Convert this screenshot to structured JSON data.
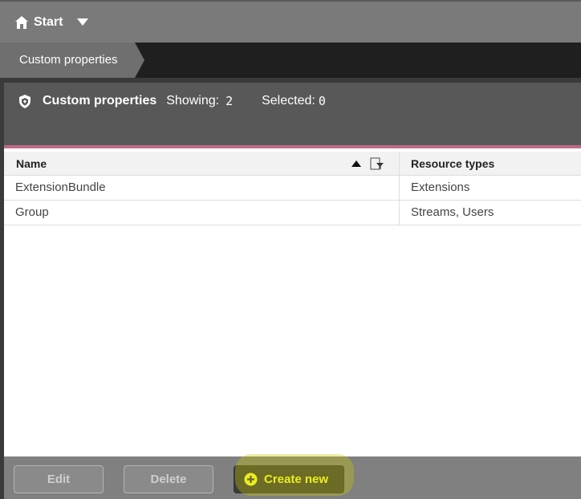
{
  "topbar": {
    "home_label": "Start"
  },
  "breadcrumb": {
    "current": "Custom properties"
  },
  "header": {
    "title": "Custom properties",
    "showing_label": "Showing:",
    "showing_count": "2",
    "selected_label": "Selected:",
    "selected_count": "0"
  },
  "table": {
    "columns": [
      "Name",
      "Resource types"
    ],
    "rows": [
      {
        "name": "ExtensionBundle",
        "resource_types": "Extensions"
      },
      {
        "name": "Group",
        "resource_types": "Streams, Users"
      }
    ]
  },
  "footer": {
    "edit_label": "Edit",
    "delete_label": "Delete",
    "create_label": "Create new"
  },
  "colors": {
    "accent_stripe": "#c06a86",
    "create_text": "#ffff33",
    "highlight": "#c8c800"
  }
}
